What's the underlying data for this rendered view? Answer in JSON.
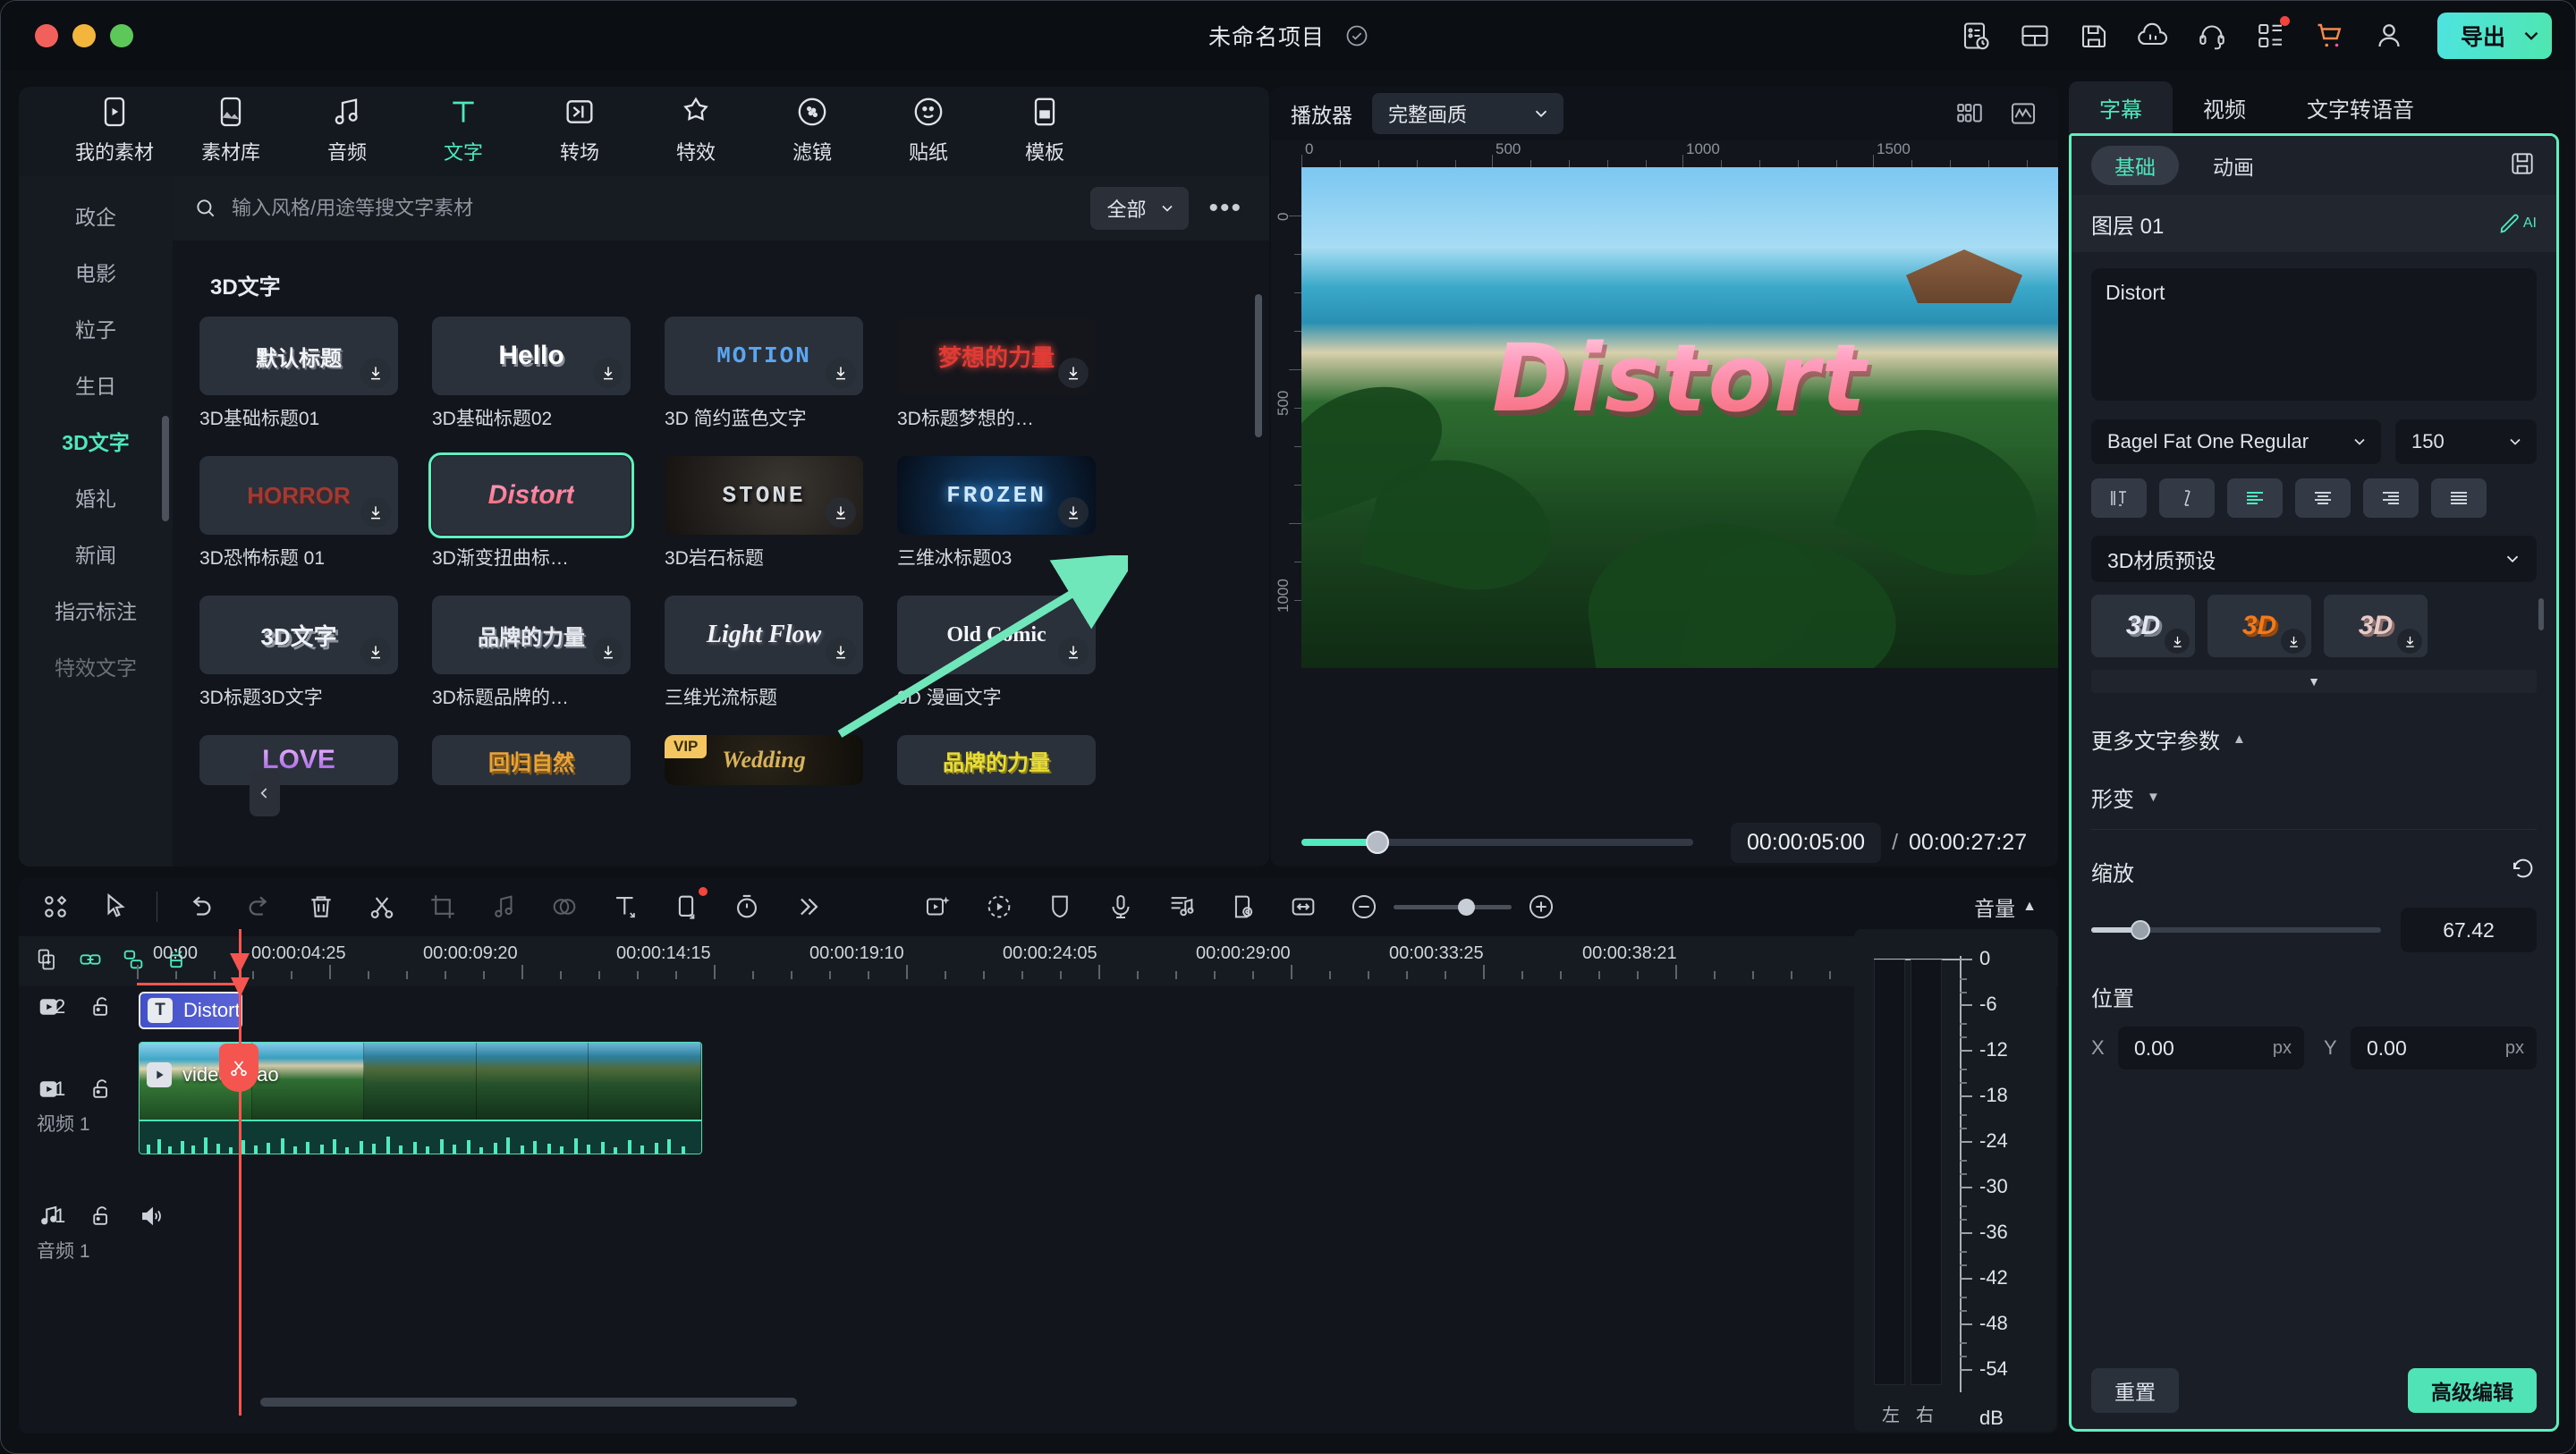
{
  "titlebar": {
    "project_name": "未命名项目",
    "check_icon": "check-circle-icon",
    "right_icons": [
      "task-list-icon",
      "layout-icon",
      "save-icon",
      "cloud-upload-icon",
      "headset-support-icon",
      "apps-grid-icon",
      "cart-icon",
      "account-icon"
    ],
    "export_label": "导出"
  },
  "nav_tabs": [
    {
      "label": "我的素材",
      "icon": "my-media-icon",
      "active": false
    },
    {
      "label": "素材库",
      "icon": "stock-library-icon",
      "active": false
    },
    {
      "label": "音频",
      "icon": "audio-icon",
      "active": false
    },
    {
      "label": "文字",
      "icon": "text-icon",
      "active": true
    },
    {
      "label": "转场",
      "icon": "transition-icon",
      "active": false
    },
    {
      "label": "特效",
      "icon": "effects-icon",
      "active": false
    },
    {
      "label": "滤镜",
      "icon": "filter-icon",
      "active": false
    },
    {
      "label": "贴纸",
      "icon": "sticker-icon",
      "active": false
    },
    {
      "label": "模板",
      "icon": "template-icon",
      "active": false
    }
  ],
  "categories": [
    {
      "label": "政企",
      "state": "normal"
    },
    {
      "label": "电影",
      "state": "normal"
    },
    {
      "label": "粒子",
      "state": "normal"
    },
    {
      "label": "生日",
      "state": "normal"
    },
    {
      "label": "3D文字",
      "state": "active"
    },
    {
      "label": "婚礼",
      "state": "normal"
    },
    {
      "label": "新闻",
      "state": "normal"
    },
    {
      "label": "指示标注",
      "state": "normal"
    },
    {
      "label": "特效文字",
      "state": "dim"
    }
  ],
  "search": {
    "placeholder": "输入风格/用途等搜文字素材",
    "value": "",
    "icon": "search-icon",
    "filter_label": "全部",
    "more_label": "•••"
  },
  "grid": {
    "title": "3D文字",
    "items": [
      {
        "label": "3D基础标题01",
        "preview": "默认标题",
        "style": "tt-default",
        "bg": "",
        "vip": false,
        "selected": false
      },
      {
        "label": "3D基础标题02",
        "preview": "Hello",
        "style": "tt-hello",
        "bg": "",
        "vip": false,
        "selected": false
      },
      {
        "label": "3D 简约蓝色文字",
        "preview": "MOTION",
        "style": "tt-motion",
        "bg": "",
        "vip": false,
        "selected": false
      },
      {
        "label": "3D标题梦想的…",
        "preview": "梦想的力量",
        "style": "tt-dream",
        "bg": "bg-dream",
        "vip": false,
        "selected": false
      },
      {
        "label": "3D恐怖标题 01",
        "preview": "HORROR",
        "style": "tt-horror",
        "bg": "",
        "vip": false,
        "selected": false
      },
      {
        "label": "3D渐变扭曲标…",
        "preview": "Distort",
        "style": "tt-distort",
        "bg": "",
        "vip": false,
        "selected": true
      },
      {
        "label": "3D岩石标题",
        "preview": "STONE",
        "style": "tt-stone",
        "bg": "bg-stone",
        "vip": false,
        "selected": false
      },
      {
        "label": "三维冰标题03",
        "preview": "FROZEN",
        "style": "tt-frozen",
        "bg": "bg-frozen",
        "vip": false,
        "selected": false
      },
      {
        "label": "3D标题3D文字",
        "preview": "3D文字",
        "style": "tt-3d",
        "bg": "",
        "vip": false,
        "selected": false
      },
      {
        "label": "3D标题品牌的…",
        "preview": "品牌的力量",
        "style": "tt-brand",
        "bg": "",
        "vip": false,
        "selected": false
      },
      {
        "label": "三维光流标题",
        "preview": "Light Flow",
        "style": "tt-light",
        "bg": "",
        "vip": false,
        "selected": false
      },
      {
        "label": "3D 漫画文字",
        "preview": "Old Comic",
        "style": "tt-oldcomic",
        "bg": "",
        "vip": false,
        "selected": false
      },
      {
        "label": "",
        "preview": "LOVE",
        "style": "tt-love",
        "bg": "",
        "vip": false,
        "selected": false
      },
      {
        "label": "",
        "preview": "回归自然",
        "style": "tt-nature",
        "bg": "",
        "vip": false,
        "selected": false
      },
      {
        "label": "",
        "preview": "Wedding",
        "style": "tt-wedding",
        "bg": "bg-wedding",
        "vip": true,
        "selected": false
      },
      {
        "label": "",
        "preview": "品牌的力量",
        "style": "tt-brandy",
        "bg": "",
        "vip": false,
        "selected": false
      }
    ]
  },
  "player": {
    "label": "播放器",
    "quality": "完整画质",
    "ruler_h": [
      "0",
      "500",
      "1000",
      "1500"
    ],
    "ruler_v": [
      "0",
      "500",
      "1000"
    ],
    "overlay_text": "Distort",
    "current_time": "00:00:05:00",
    "separator": "/",
    "total_time": "00:00:27:27",
    "controls": [
      "prev-frame-icon",
      "next-frame-icon",
      "play-icon",
      "stop-icon",
      "mark-in-icon",
      "mark-out-icon",
      "keyframe-icon",
      "chevron-down-icon",
      "display-mode-icon",
      "snapshot-icon",
      "mute-icon",
      "fullscreen-icon"
    ],
    "head_icons": [
      "split-view-icon",
      "waveform-icon"
    ]
  },
  "right_panel": {
    "tabs": [
      {
        "label": "字幕",
        "active": true
      },
      {
        "label": "视频",
        "active": false
      },
      {
        "label": "文字转语音",
        "active": false
      }
    ],
    "segments": [
      {
        "label": "基础",
        "active": true
      },
      {
        "label": "动画",
        "active": false
      }
    ],
    "save_icon": "save-preset-icon",
    "layer_name": "图层 01",
    "ai_label": "AI",
    "text_value": "Distort",
    "font_name": "Bagel Fat One Regular",
    "font_size": "150",
    "align_buttons": [
      "vertical-text-icon",
      "italic-icon",
      "align-left-icon",
      "align-center-icon",
      "align-right-icon",
      "align-justify-icon"
    ],
    "material_preset_label": "3D材质预设",
    "material_items": [
      "3D",
      "3D",
      "3D"
    ],
    "more_text_params_label": "更多文字参数",
    "deform_label": "形变",
    "scale_label": "缩放",
    "scale_value": "67.42",
    "position_label": "位置",
    "x_label": "X",
    "x_value": "0.00",
    "x_unit": "px",
    "y_label": "Y",
    "y_value": "0.00",
    "y_unit": "px",
    "reset_label": "重置",
    "advanced_label": "高级编辑"
  },
  "timeline": {
    "toolbar_left": [
      "grid-view-icon",
      "select-tool-icon",
      "undo-icon",
      "redo-icon",
      "delete-icon",
      "split-icon",
      "crop-icon",
      "audio-detach-icon",
      "color-match-icon",
      "text-tool-icon",
      "mask-icon",
      "speed-icon",
      "more-icon"
    ],
    "toolbar_right": [
      "ai-video-icon",
      "motion-tracking-icon",
      "shield-icon",
      "voice-record-icon",
      "auto-beat-icon",
      "marker-icon",
      "fit-timeline-icon",
      "zoom-out-icon",
      "zoom-in-icon"
    ],
    "volume_label": "音量",
    "head_icons": [
      "add-track-icon",
      "link-icon",
      "group-icon",
      "magnet-icon"
    ],
    "ruler_labels": [
      "00:00",
      "00:00:04:25",
      "00:00:09:20",
      "00:00:14:15",
      "00:00:19:10",
      "00:00:24:05",
      "00:00:29:00",
      "00:00:33:25",
      "00:00:38:21"
    ],
    "tracks": [
      {
        "num": "2",
        "type": "video",
        "name": "",
        "icons": [
          "track-video-icon",
          "lock-icon",
          "speaker-icon",
          "eye-icon"
        ]
      },
      {
        "num": "1",
        "type": "video",
        "name": "视频 1",
        "icons": [
          "track-video-icon",
          "lock-icon",
          "speaker-icon",
          "eye-icon"
        ]
      },
      {
        "num": "1",
        "type": "audio",
        "name": "音频 1",
        "icons": [
          "track-audio-icon",
          "lock-icon",
          "speaker-icon"
        ]
      }
    ],
    "clips": [
      {
        "name": "Distort",
        "type": "text",
        "icon": "text-clip-icon"
      },
      {
        "name": "video-miao",
        "type": "video",
        "icon": "play-clip-icon"
      }
    ]
  },
  "volume_meter": {
    "labels": [
      "0",
      "-6",
      "-12",
      "-18",
      "-24",
      "-30",
      "-36",
      "-42",
      "-48",
      "-54"
    ],
    "unit": "dB",
    "left_label": "左",
    "right_label": "右"
  },
  "colors": {
    "accent": "#4de8bb",
    "accent_bright": "#5ff0c0",
    "playhead": "#f4564f",
    "clip_text": "#4251c9",
    "panel_bg": "#1a1f27",
    "app_bg": "#0d1015"
  }
}
